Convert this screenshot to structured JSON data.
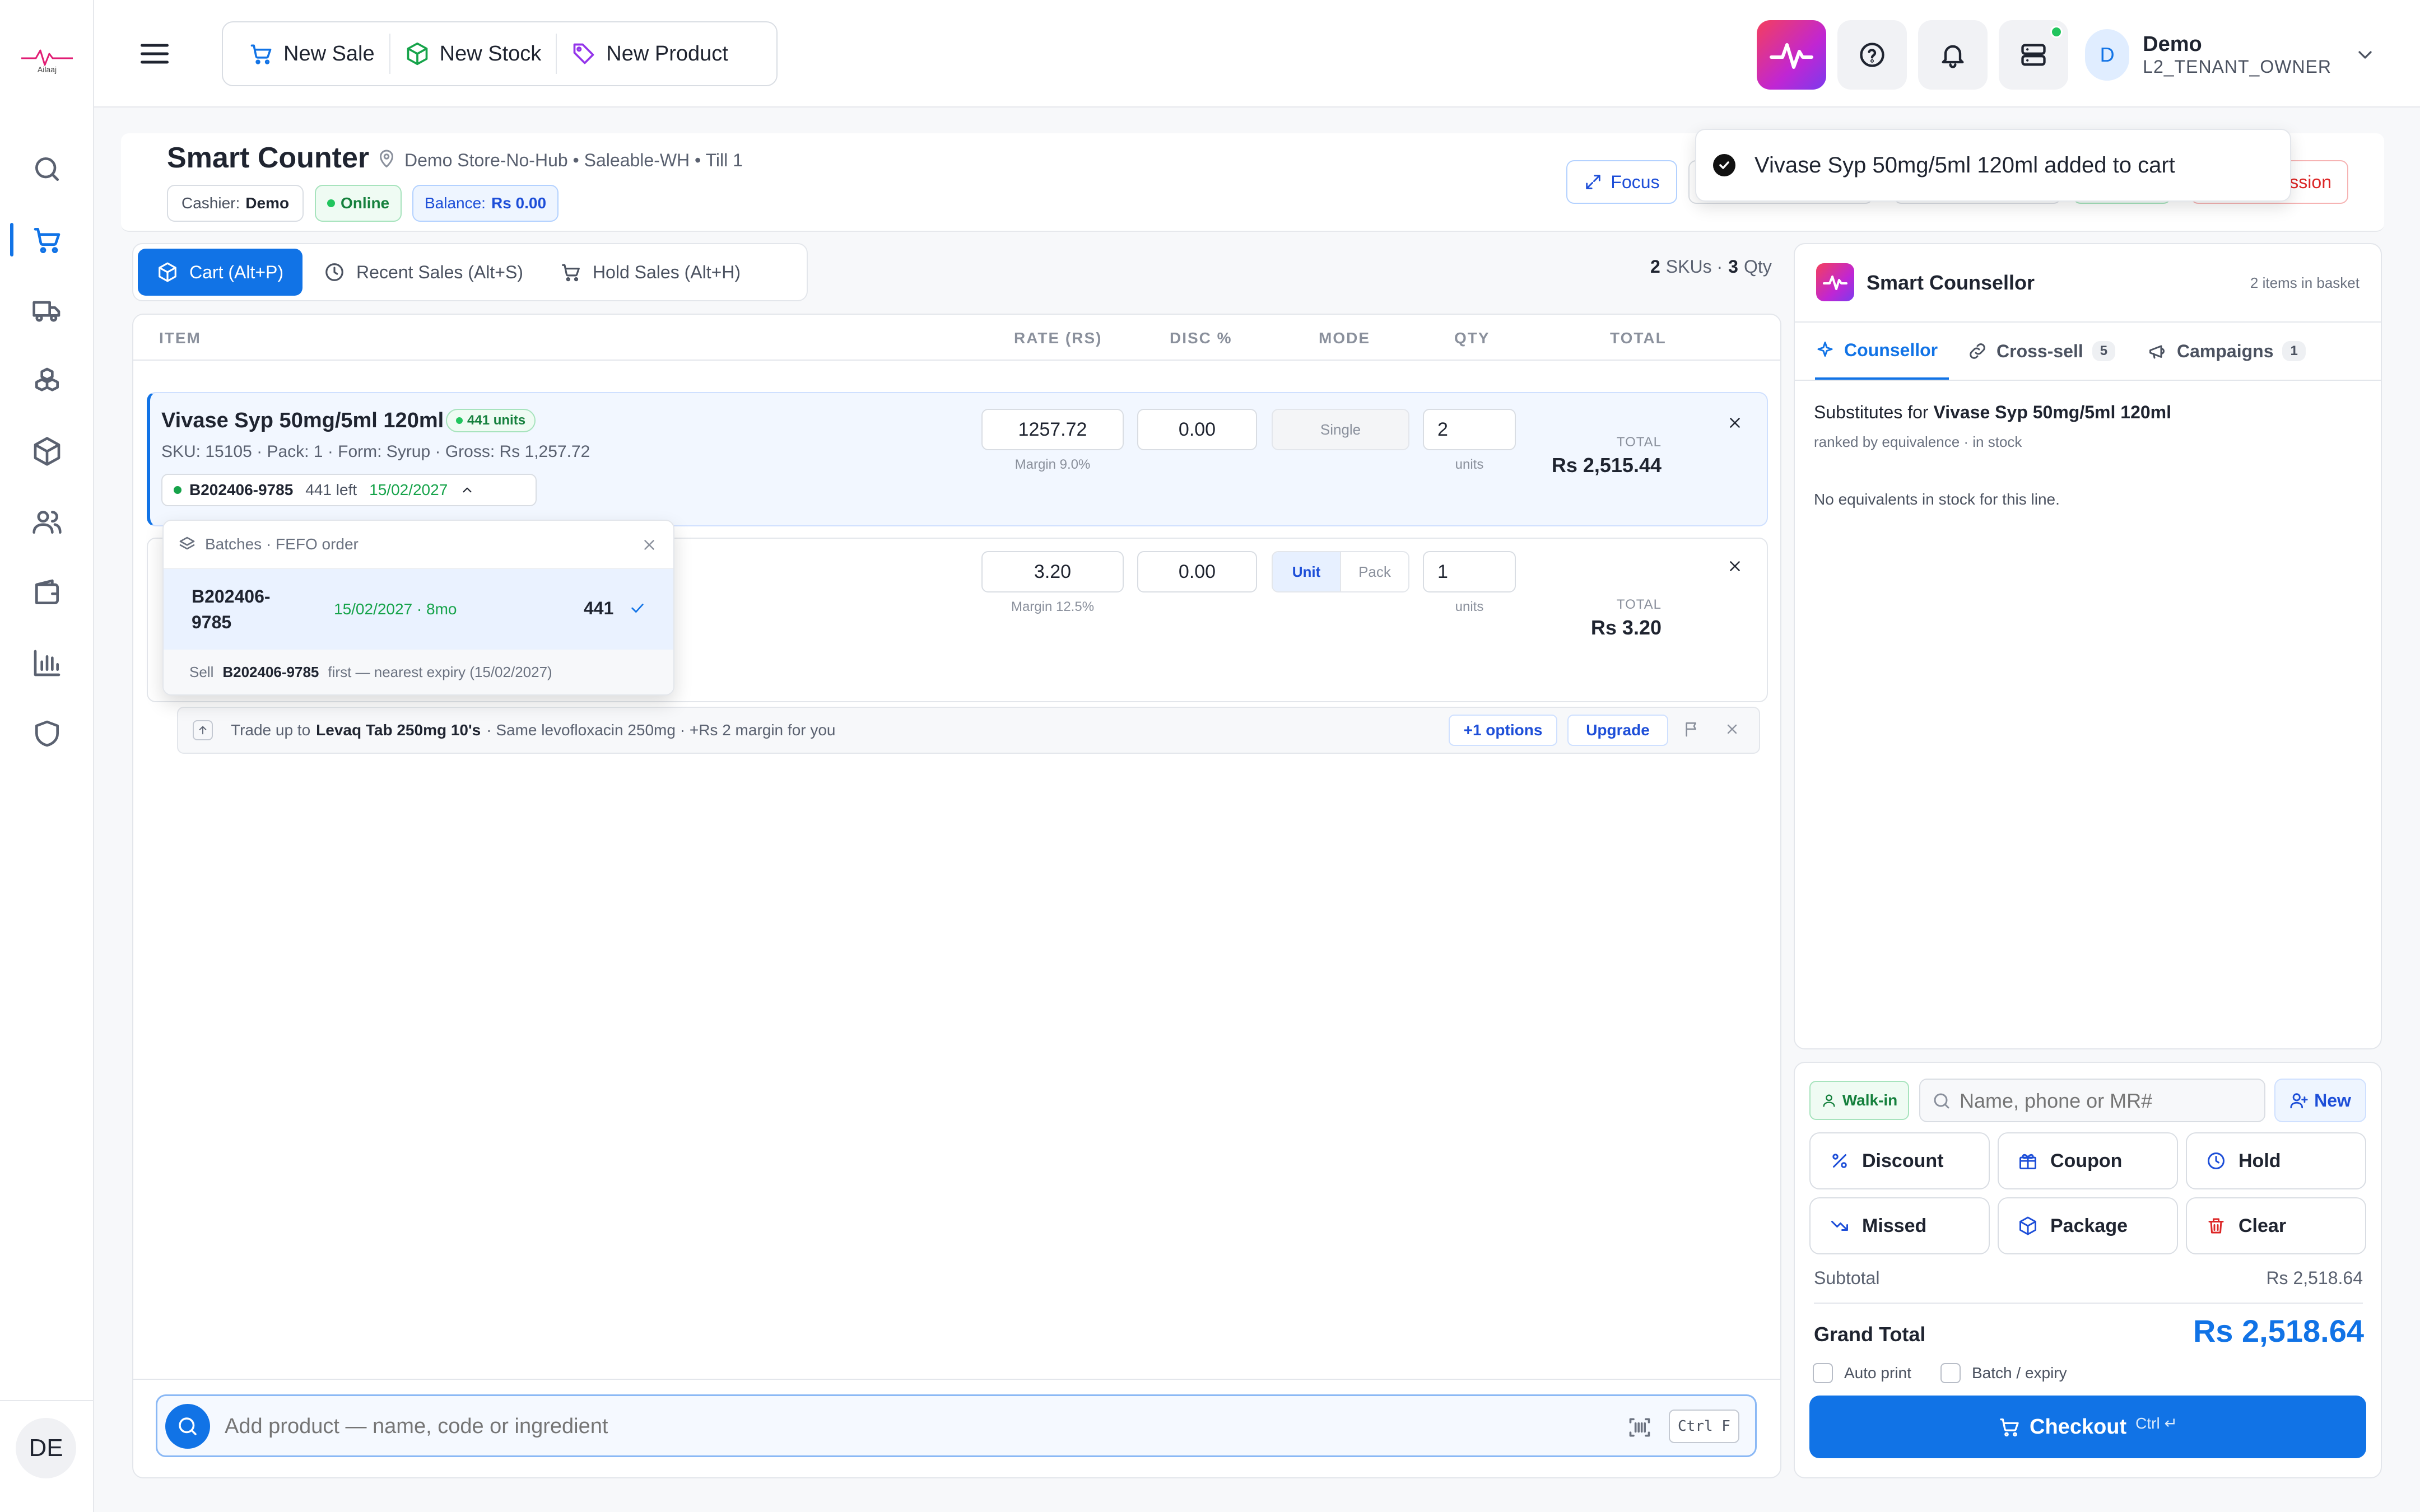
{
  "app": {
    "logo_text": "Ailaaj",
    "user_initials": "DE"
  },
  "topbar": {
    "quick_actions": [
      "New Sale",
      "New Stock",
      "New Product"
    ],
    "user": {
      "name": "Demo",
      "role": "L2_TENANT_OWNER",
      "avatar": "D"
    }
  },
  "toast": {
    "message": "Vivase Syp 50mg/5ml 120ml added to cart"
  },
  "header": {
    "title": "Smart Counter",
    "location": "Demo Store-No-Hub • Saleable-WH • Till 1",
    "cashier_label": "Cashier:",
    "cashier": "Demo",
    "status": "Online",
    "balance_label": "Balance:",
    "balance": "Rs 0.00",
    "focus_label": "Focus",
    "session_label_partial": "ssion"
  },
  "tabs": [
    {
      "label": "Cart (Alt+P)",
      "active": true,
      "icon": "box-icon"
    },
    {
      "label": "Recent Sales (Alt+S)",
      "active": false,
      "icon": "clock-icon"
    },
    {
      "label": "Hold Sales (Alt+H)",
      "active": false,
      "icon": "cart-icon"
    }
  ],
  "summary": {
    "skus": "2",
    "skus_label": "SKUs ·",
    "qty": "3",
    "qty_label": "Qty"
  },
  "table": {
    "columns": [
      "ITEM",
      "RATE (RS)",
      "DISC %",
      "MODE",
      "QTY",
      "TOTAL"
    ],
    "rows": [
      {
        "name": "Vivase Syp 50mg/5ml 120ml",
        "units_badge": "441 units",
        "meta": "SKU: 15105 · Pack: 1 · Form: Syrup · Gross: Rs 1,257.72",
        "batch": "B202406-9785",
        "batch_left": "441 left",
        "batch_expiry": "15/02/2027",
        "rate": "1257.72",
        "margin": "Margin 9.0%",
        "disc": "0.00",
        "mode": "Single",
        "qty": "2",
        "qty_unit": "units",
        "total_label": "TOTAL",
        "total": "Rs 2,515.44"
      },
      {
        "rate": "3.20",
        "margin": "Margin 12.5%",
        "disc": "0.00",
        "mode_options": [
          "Unit",
          "Pack"
        ],
        "qty": "1",
        "qty_unit": "units",
        "total_label": "TOTAL",
        "total": "Rs 3.20"
      }
    ]
  },
  "batch_popup": {
    "title": "Batches · FEFO order",
    "batch_line1": "B202406-",
    "batch_line2": "9785",
    "expiry": "15/02/2027 · 8mo",
    "qty": "441",
    "footer_prefix": "Sell",
    "footer_batch": "B202406-9785",
    "footer_suffix": "first — nearest expiry (15/02/2027)"
  },
  "upsell": {
    "prefix": "Trade up to",
    "product": "Levaq Tab 250mg 10's",
    "suffix": "· Same levofloxacin 250mg · +Rs 2 margin for you",
    "options": "+1 options",
    "upgrade": "Upgrade"
  },
  "search": {
    "placeholder": "Add product — name, code or ingredient",
    "shortcut": "Ctrl F"
  },
  "counsellor": {
    "title": "Smart Counsellor",
    "basket": "2 items in basket",
    "tabs": [
      {
        "label": "Counsellor",
        "badge": ""
      },
      {
        "label": "Cross-sell",
        "badge": "5"
      },
      {
        "label": "Campaigns",
        "badge": "1"
      }
    ],
    "subs_prefix": "Substitutes for",
    "subs_product": "Vivase Syp 50mg/5ml 120ml",
    "subs_note": "ranked by equivalence · in stock",
    "empty": "No equivalents in stock for this line."
  },
  "checkout": {
    "walkin": "Walk-in",
    "customer_placeholder": "Name, phone or MR#",
    "new_label": "New",
    "actions": [
      "Discount",
      "Coupon",
      "Hold",
      "Missed",
      "Package",
      "Clear"
    ],
    "subtotal_label": "Subtotal",
    "subtotal": "Rs 2,518.64",
    "grand_label": "Grand Total",
    "grand": "Rs 2,518.64",
    "auto_print": "Auto print",
    "batch_expiry": "Batch / expiry",
    "checkout_label": "Checkout",
    "checkout_shortcut": "Ctrl ↵"
  },
  "colors": {
    "primary": "#1173e6",
    "success": "#16a34a",
    "danger": "#dc2626",
    "border": "#e3e6eb"
  }
}
